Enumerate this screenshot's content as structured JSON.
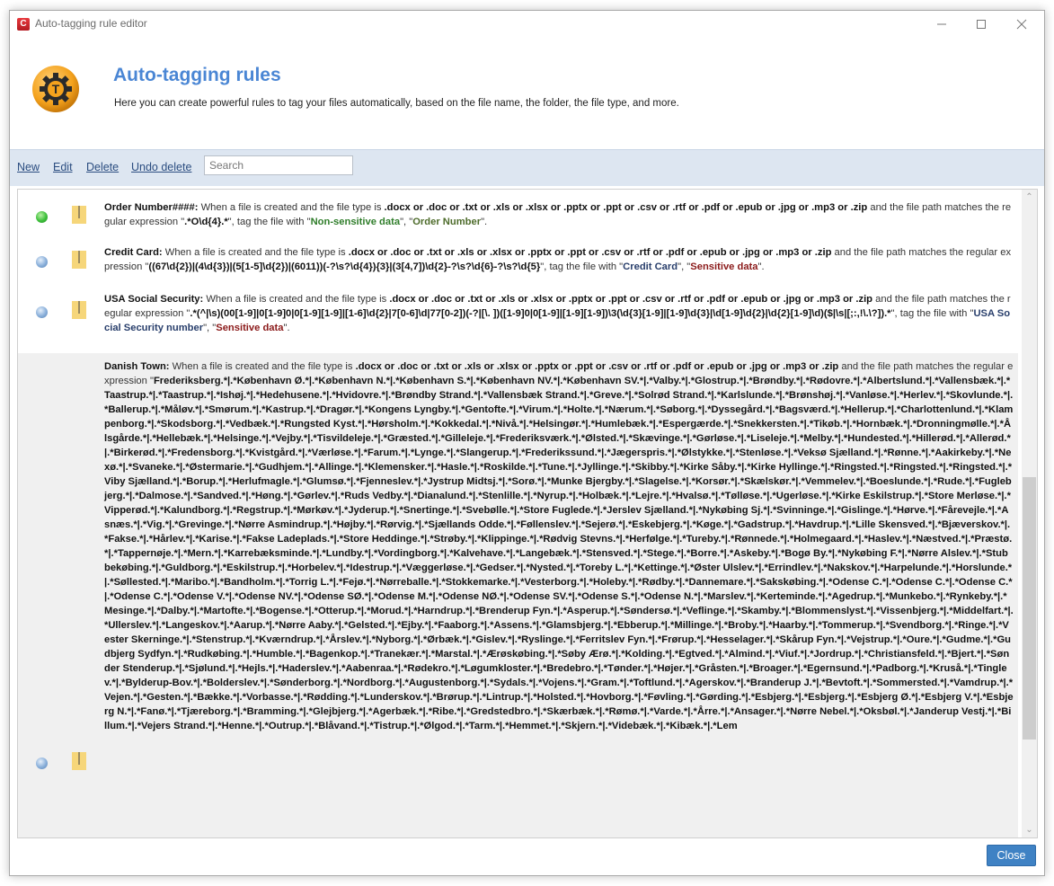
{
  "window": {
    "title": "Auto-tagging rule editor",
    "app_icon_letter": "C",
    "controls": [
      "minimize",
      "maximize",
      "close"
    ]
  },
  "header": {
    "title": "Auto-tagging rules",
    "description": "Here you can create powerful rules to tag your files automatically, based on the file name, the folder, the file type, and more."
  },
  "toolbar": {
    "new_label": "New",
    "edit_label": "Edit",
    "delete_label": "Delete",
    "undo_delete_label": "Undo delete",
    "search_placeholder": "Search",
    "search_value": ""
  },
  "common": {
    "when": " When a file is created  and the file type is ",
    "file_types": ".docx or .doc or .txt or .xls or .xlsx or .pptx or .ppt or .csv or .rtf or .pdf or .epub or .jpg or .mp3 or .zip",
    "path_matches": " and the file path matches the regular expression \"",
    "tag_with": "\", tag the file with  \"",
    "sep": "\", \"",
    "end": "\"."
  },
  "rules": [
    {
      "name": "Order Number####:",
      "status": "enabled",
      "status_color": "#3cbf3a",
      "regex": ".*O\\d{4}.*",
      "tags": [
        {
          "label": "Non-sensitive data",
          "color": "#2f7d2a"
        },
        {
          "label": "Order Number",
          "color": "#4d6b2a"
        }
      ]
    },
    {
      "name": "Credit Card:",
      "status": "disabled",
      "status_color": "#88aed9",
      "regex": "((67\\d{2})|(4\\d{3})|(5[1-5]\\d{2})|(6011))(-?\\s?\\d{4}){3}|(3[4,7])\\d{2}-?\\s?\\d{6}-?\\s?\\d{5}",
      "tags": [
        {
          "label": "Credit Card",
          "color": "#283e6b"
        },
        {
          "label": "Sensitive data",
          "color": "#8b1a1a"
        }
      ]
    },
    {
      "name": "USA  Social Security:",
      "status": "disabled",
      "status_color": "#88aed9",
      "regex": ".*(^|\\s)(00[1-9]|0[1-9]0|0[1-9][1-9]|[1-6]\\d{2}|7[0-6]\\d|77[0-2])(-?|[\\. ])([1-9]0|0[1-9]|[1-9][1-9])\\3(\\d{3}[1-9]|[1-9]\\d{3}|\\d[1-9]\\d{2}|\\d{2}[1-9]\\d)($|\\s|[;:,!\\.\\?]).*",
      "tags": [
        {
          "label": "USA Social Security number",
          "color": "#283e6b"
        },
        {
          "label": "Sensitive data",
          "color": "#8b1a1a"
        }
      ]
    },
    {
      "name": "Danish Town:",
      "status": "disabled",
      "status_color": "#88aed9",
      "selected": true,
      "regex": "Frederiksberg.*|.*København Ø.*|.*København N.*|.*København S.*|.*København NV.*|.*København SV.*|.*Valby.*|.*Glostrup.*|.*Brøndby.*|.*Rødovre.*|.*Albertslund.*|.*Vallensbæk.*|.*Taastrup.*|.*Taastrup.*|.*Ishøj.*|.*Hedehusene.*|.*Hvidovre.*|.*Brøndby Strand.*|.*Vallensbæk Strand.*|.*Greve.*|.*Solrød Strand.*|.*Karlslunde.*|.*Brønshøj.*|.*Vanløse.*|.*Herlev.*|.*Skovlunde.*|.*Ballerup.*|.*Måløv.*|.*Smørum.*|.*Kastrup.*|.*Dragør.*|.*Kongens Lyngby.*|.*Gentofte.*|.*Virum.*|.*Holte.*|.*Nærum.*|.*Søborg.*|.*Dyssegård.*|.*Bagsværd.*|.*Hellerup.*|.*Charlottenlund.*|.*Klampenborg.*|.*Skodsborg.*|.*Vedbæk.*|.*Rungsted Kyst.*|.*Hørsholm.*|.*Kokkedal.*|.*Nivå.*|.*Helsingør.*|.*Humlebæk.*|.*Espergærde.*|.*Snekkersten.*|.*Tikøb.*|.*Hornbæk.*|.*Dronningmølle.*|.*Ålsgårde.*|.*Hellebæk.*|.*Helsinge.*|.*Vejby.*|.*Tisvildeleje.*|.*Græsted.*|.*Gilleleje.*|.*Frederiksværk.*|.*Ølsted.*|.*Skævinge.*|.*Gørløse.*|.*Liseleje.*|.*Melby.*|.*Hundested.*|.*Hillerød.*|.*Allerød.*|.*Birkerød.*|.*Fredensborg.*|.*Kvistgård.*|.*Værløse.*|.*Farum.*|.*Lynge.*|.*Slangerup.*|.*Frederikssund.*|.*Jægerspris.*|.*Ølstykke.*|.*Stenløse.*|.*Veksø Sjælland.*|.*Rønne.*|.*Aakirkeby.*|.*Nexø.*|.*Svaneke.*|.*Østermarie.*|.*Gudhjem.*|.*Allinge.*|.*Klemensker.*|.*Hasle.*|.*Roskilde.*|.*Tune.*|.*Jyllinge.*|.*Skibby.*|.*Kirke Såby.*|.*Kirke Hyllinge.*|.*Ringsted.*|.*Ringsted.*|.*Ringsted.*|.*Viby Sjælland.*|.*Borup.*|.*Herlufmagle.*|.*Glumsø.*|.*Fjenneslev.*|.*Jystrup Midtsj.*|.*Sorø.*|.*Munke Bjergby.*|.*Slagelse.*|.*Korsør.*|.*Skælskør.*|.*Vemmelev.*|.*Boeslunde.*|.*Rude.*|.*Fuglebjerg.*|.*Dalmose.*|.*Sandved.*|.*Høng.*|.*Gørlev.*|.*Ruds Vedby.*|.*Dianalund.*|.*Stenlille.*|.*Nyrup.*|.*Holbæk.*|.*Lejre.*|.*Hvalsø.*|.*Tølløse.*|.*Ugerløse.*|.*Kirke Eskilstrup.*|.*Store Merløse.*|.*Vipperød.*|.*Kalundborg.*|.*Regstrup.*|.*Mørkøv.*|.*Jyderup.*|.*Snertinge.*|.*Svebølle.*|.*Store Fuglede.*|.*Jerslev Sjælland.*|.*Nykøbing Sj.*|.*Svinninge.*|.*Gislinge.*|.*Hørve.*|.*Fårevejle.*|.*Asnæs.*|.*Vig.*|.*Grevinge.*|.*Nørre Asmindrup.*|.*Højby.*|.*Rørvig.*|.*Sjællands Odde.*|.*Føllenslev.*|.*Sejerø.*|.*Eskebjerg.*|.*Køge.*|.*Gadstrup.*|.*Havdrup.*|.*Lille Skensved.*|.*Bjæverskov.*|.*Fakse.*|.*Hårlev.*|.*Karise.*|.*Fakse Ladeplads.*|.*Store Heddinge.*|.*Strøby.*|.*Klippinge.*|.*Rødvig Stevns.*|.*Herfølge.*|.*Tureby.*|.*Rønnede.*|.*Holmegaard.*|.*Haslev.*|.*Næstved.*|.*Præstø.*|.*Tappernøje.*|.*Mern.*|.*Karrebæksminde.*|.*Lundby.*|.*Vordingborg.*|.*Kalvehave.*|.*Langebæk.*|.*Stensved.*|.*Stege.*|.*Borre.*|.*Askeby.*|.*Bogø By.*|.*Nykøbing F.*|.*Nørre Alslev.*|.*Stubbekøbing.*|.*Guldborg.*|.*Eskilstrup.*|.*Horbelev.*|.*Idestrup.*|.*Væggerløse.*|.*Gedser.*|.*Nysted.*|.*Toreby L.*|.*Kettinge.*|.*Øster Ulslev.*|.*Errindlev.*|.*Nakskov.*|.*Harpelunde.*|.*Horslunde.*|.*Søllested.*|.*Maribo.*|.*Bandholm.*|.*Torrig L.*|.*Fejø.*|.*Nørreballe.*|.*Stokkemarke.*|.*Vesterborg.*|.*Holeby.*|.*Rødby.*|.*Dannemare.*|.*Sakskøbing.*|.*Odense C.*|.*Odense C.*|.*Odense C.*|.*Odense C.*|.*Odense V.*|.*Odense NV.*|.*Odense SØ.*|.*Odense M.*|.*Odense NØ.*|.*Odense SV.*|.*Odense S.*|.*Odense N.*|.*Marslev.*|.*Kerteminde.*|.*Agedrup.*|.*Munkebo.*|.*Rynkeby.*|.*Mesinge.*|.*Dalby.*|.*Martofte.*|.*Bogense.*|.*Otterup.*|.*Morud.*|.*Harndrup.*|.*Brenderup Fyn.*|.*Asperup.*|.*Søndersø.*|.*Veflinge.*|.*Skamby.*|.*Blommenslyst.*|.*Vissenbjerg.*|.*Middelfart.*|.*Ullerslev.*|.*Langeskov.*|.*Aarup.*|.*Nørre Aaby.*|.*Gelsted.*|.*Ejby.*|.*Faaborg.*|.*Assens.*|.*Glamsbjerg.*|.*Ebberup.*|.*Millinge.*|.*Broby.*|.*Haarby.*|.*Tommerup.*|.*Svendborg.*|.*Ringe.*|.*Vester Skerninge.*|.*Stenstrup.*|.*Kværndrup.*|.*Årslev.*|.*Nyborg.*|.*Ørbæk.*|.*Gislev.*|.*Ryslinge.*|.*Ferritslev Fyn.*|.*Frørup.*|.*Hesselager.*|.*Skårup Fyn.*|.*Vejstrup.*|.*Oure.*|.*Gudme.*|.*Gudbjerg Sydfyn.*|.*Rudkøbing.*|.*Humble.*|.*Bagenkop.*|.*Tranekær.*|.*Marstal.*|.*Ærøskøbing.*|.*Søby Ærø.*|.*Kolding.*|.*Egtved.*|.*Almind.*|.*Viuf.*|.*Jordrup.*|.*Christiansfeld.*|.*Bjert.*|.*Sønder Stenderup.*|.*Sjølund.*|.*Hejls.*|.*Haderslev.*|.*Aabenraa.*|.*Rødekro.*|.*Løgumkloster.*|.*Bredebro.*|.*Tønder.*|.*Højer.*|.*Gråsten.*|.*Broager.*|.*Egernsund.*|.*Padborg.*|.*Kruså.*|.*Tinglev.*|.*Bylderup-Bov.*|.*Bolderslev.*|.*Sønderborg.*|.*Nordborg.*|.*Augustenborg.*|.*Sydals.*|.*Vojens.*|.*Gram.*|.*Toftlund.*|.*Agerskov.*|.*Branderup J.*|.*Bevtoft.*|.*Sommersted.*|.*Vamdrup.*|.*Vejen.*|.*Gesten.*|.*Bække.*|.*Vorbasse.*|.*Rødding.*|.*Lunderskov.*|.*Brørup.*|.*Lintrup.*|.*Holsted.*|.*Hovborg.*|.*Føvling.*|.*Gørding.*|.*Esbjerg.*|.*Esbjerg.*|.*Esbjerg Ø.*|.*Esbjerg V.*|.*Esbjerg N.*|.*Fanø.*|.*Tjæreborg.*|.*Bramming.*|.*Glejbjerg.*|.*Agerbæk.*|.*Ribe.*|.*Gredstedbro.*|.*Skærbæk.*|.*Rømø.*|.*Varde.*|.*Årre.*|.*Ansager.*|.*Nørre Nebel.*|.*Oksbøl.*|.*Janderup Vestj.*|.*Billum.*|.*Vejers Strand.*|.*Henne.*|.*Outrup.*|.*Blåvand.*|.*Tistrup.*|.*Ølgod.*|.*Tarm.*|.*Hemmet.*|.*Skjern.*|.*Videbæk.*|.*Kibæk.*|.*Lem",
      "tags": []
    }
  ],
  "footer": {
    "close_label": "Close"
  }
}
